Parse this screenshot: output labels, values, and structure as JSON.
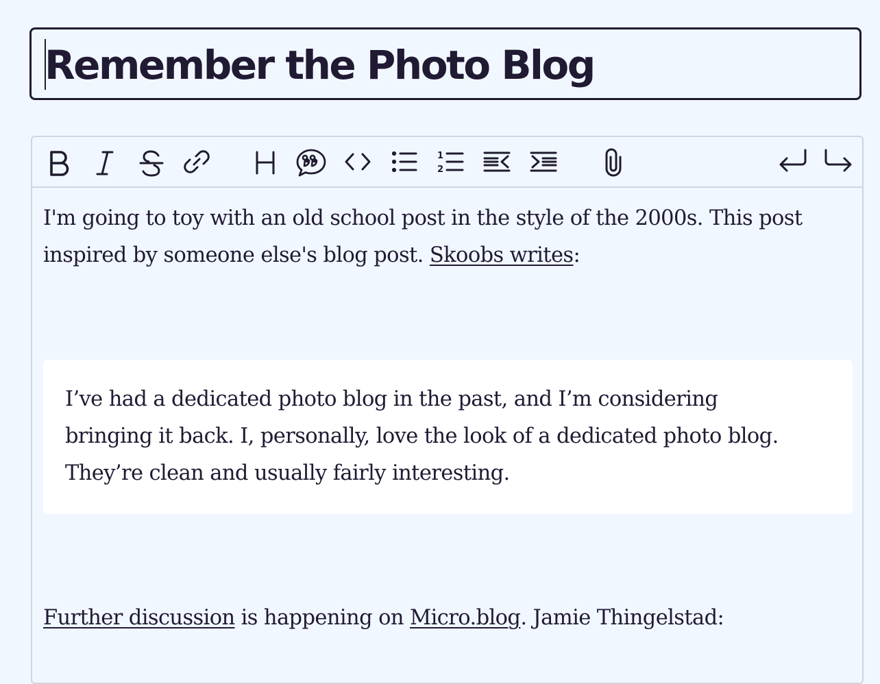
{
  "title": {
    "value": "Remember the Photo Blog"
  },
  "toolbar": {
    "buttons": [
      {
        "name": "bold-button",
        "icon": "bold-icon"
      },
      {
        "name": "italic-button",
        "icon": "italic-icon"
      },
      {
        "name": "strikethrough-button",
        "icon": "strikethrough-icon"
      },
      {
        "name": "link-button",
        "icon": "link-icon"
      },
      {
        "name": "heading-button",
        "icon": "heading-icon"
      },
      {
        "name": "quote-button",
        "icon": "quote-icon"
      },
      {
        "name": "code-button",
        "icon": "code-icon"
      },
      {
        "name": "bullet-list-button",
        "icon": "bullet-list-icon"
      },
      {
        "name": "numbered-list-button",
        "icon": "numbered-list-icon"
      },
      {
        "name": "outdent-button",
        "icon": "outdent-icon"
      },
      {
        "name": "indent-button",
        "icon": "indent-icon"
      },
      {
        "name": "attach-button",
        "icon": "paperclip-icon"
      },
      {
        "name": "undo-button",
        "icon": "undo-icon"
      },
      {
        "name": "redo-button",
        "icon": "redo-icon"
      }
    ],
    "heading_glyph": "H",
    "numbered_digits": [
      "1",
      "2"
    ]
  },
  "content": {
    "p1": {
      "line1": "I'm going to toy with an old school post in the style of the 2000s. This post",
      "line2_before": "inspired by someone else's blog post.",
      "link": "Skoobs writes",
      "line2_after": ":"
    },
    "quote": {
      "line1": "I’ve had a dedicated photo blog in the past, and I’m considering",
      "line2": "bringing it back. I, personally, love the look of a dedicated photo blog.",
      "line3": "They’re clean and usually fairly interesting."
    },
    "p2": {
      "link1": "Further discussion",
      "middle": " is happening on ",
      "link2": "Micro.blog",
      "after": ". Jamie Thingelstad:"
    }
  }
}
